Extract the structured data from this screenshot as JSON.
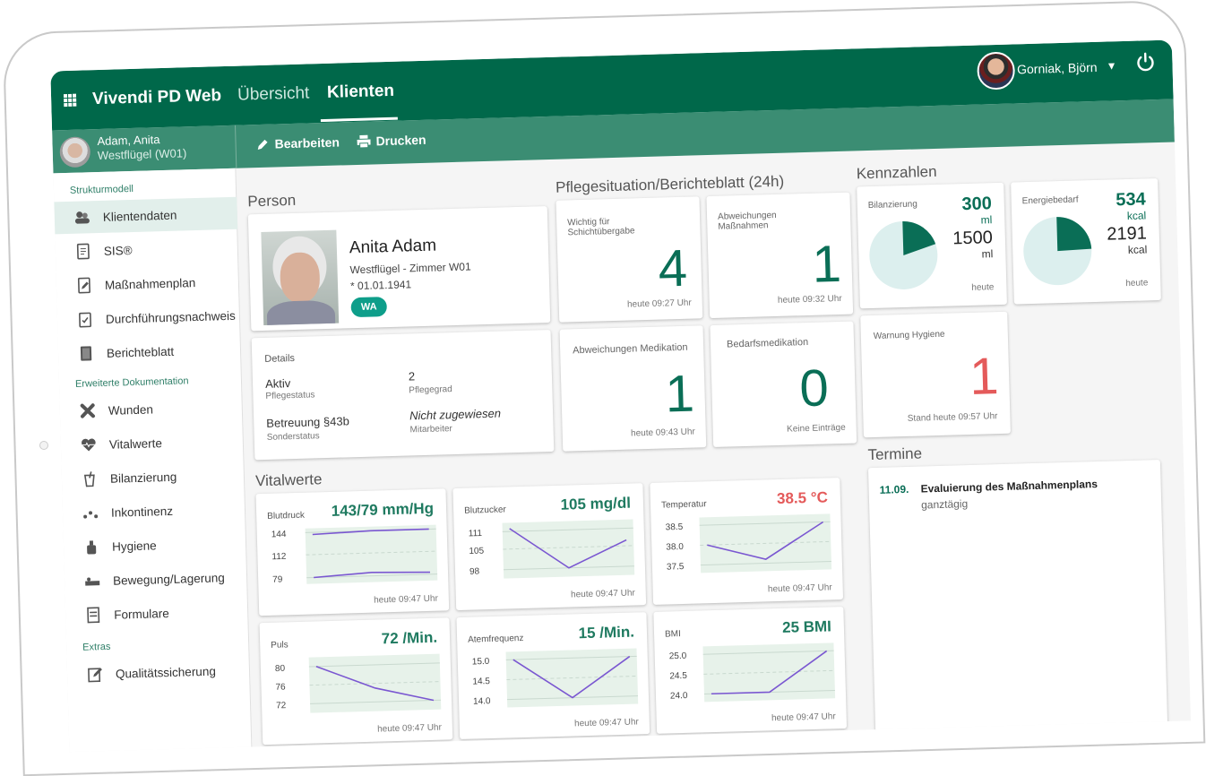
{
  "header": {
    "app_title": "Vivendi PD Web",
    "tabs": [
      {
        "label": "Übersicht"
      },
      {
        "label": "Klienten"
      }
    ],
    "user_name": "Gorniak, Björn"
  },
  "client": {
    "name": "Adam, Anita",
    "ward": "Westflügel (W01)"
  },
  "toolbar": {
    "edit_label": "Bearbeiten",
    "print_label": "Drucken"
  },
  "sidebar": {
    "sections": [
      "Strukturmodell",
      "Erweiterte Dokumentation",
      "Extras"
    ],
    "items": [
      "Klientendaten",
      "SIS®",
      "Maßnahmenplan",
      "Durchführungsnachweis",
      "Berichteblatt",
      "Wunden",
      "Vitalwerte",
      "Bilanzierung",
      "Inkontinenz",
      "Hygiene",
      "Bewegung/Lagerung",
      "Formulare",
      "Qualitätssicherung"
    ]
  },
  "person": {
    "section": "Person",
    "name": "Anita Adam",
    "location": "Westflügel - Zimmer W01",
    "birth": "* 01.01.1941",
    "badge": "WA",
    "details_title": "Details",
    "status": "Aktiv",
    "status_label": "Pflegestatus",
    "grade": "2",
    "grade_label": "Pflegegrad",
    "special": "Betreuung §43b",
    "special_label": "Sonderstatus",
    "staff": "Nicht zugewiesen",
    "staff_label": "Mitarbeiter"
  },
  "situation": {
    "section": "Pflegesituation/Berichteblatt (24h)",
    "cards": [
      {
        "title": "Wichtig für Schichtübergabe",
        "value": "4",
        "footer": "heute 09:27 Uhr"
      },
      {
        "title": "Abweichungen Maßnahmen",
        "value": "1",
        "footer": "heute 09:32 Uhr"
      },
      {
        "title": "Abweichungen Medikation",
        "value": "1",
        "footer": "heute 09:43 Uhr"
      },
      {
        "title": "Bedarfsmedikation",
        "value": "0",
        "footer": "Keine Einträge"
      }
    ]
  },
  "kennzahlen": {
    "section": "Kennzahlen",
    "bilanz": {
      "title": "Bilanzierung",
      "value": "300",
      "unit": "ml",
      "total": "1500",
      "total_unit": "ml",
      "footer": "heute",
      "fraction": 0.2
    },
    "energie": {
      "title": "Energiebedarf",
      "value": "534",
      "unit": "kcal",
      "total": "2191",
      "total_unit": "kcal",
      "footer": "heute",
      "fraction": 0.244
    },
    "hygiene": {
      "title": "Warnung Hygiene",
      "value": "1",
      "footer": "Stand heute 09:57 Uhr"
    }
  },
  "termine": {
    "section": "Termine",
    "date": "11.09.",
    "title": "Evaluierung des Maßnahmenplans",
    "time": "ganztägig"
  },
  "colors": {
    "primary": "#00684a",
    "secondary": "#3b8d73",
    "warning": "#e45a5a",
    "series": "#7a57d1"
  },
  "vitals": {
    "section": "Vitalwerte",
    "footer": "heute 09:47 Uhr",
    "chart_data": [
      {
        "type": "line",
        "title": "Blutdruck",
        "value_label": "143/79 mm/Hg",
        "ticks": [
          "144",
          "112",
          "79"
        ],
        "ylim": [
          70,
          150
        ],
        "series": [
          {
            "values": [
              141,
              144,
              144
            ]
          },
          {
            "values": [
              79,
              84,
              82
            ]
          }
        ]
      },
      {
        "type": "line",
        "title": "Blutzucker",
        "value_label": "105 mg/dl",
        "ticks": [
          "111",
          "105",
          "98"
        ],
        "ylim": [
          95,
          114
        ],
        "series": [
          {
            "values": [
              112,
              98,
              107
            ]
          }
        ]
      },
      {
        "type": "line",
        "title": "Temperatur",
        "value_label": "38.5 °C",
        "ticks": [
          "38.5",
          "38.0",
          "37.5"
        ],
        "ylim": [
          37.3,
          38.7
        ],
        "series": [
          {
            "values": [
              38.0,
              37.6,
              38.5
            ]
          }
        ]
      },
      {
        "type": "line",
        "title": "Puls",
        "value_label": "72 /Min.",
        "ticks": [
          "80",
          "76",
          "72"
        ],
        "ylim": [
          70,
          82
        ],
        "series": [
          {
            "values": [
              80,
              75,
              72
            ]
          }
        ]
      },
      {
        "type": "line",
        "title": "Atemfrequenz",
        "value_label": "15 /Min.",
        "ticks": [
          "15.0",
          "14.5",
          "14.0"
        ],
        "ylim": [
          13.8,
          15.2
        ],
        "series": [
          {
            "values": [
              15.0,
              14.0,
              15.0
            ]
          }
        ]
      },
      {
        "type": "line",
        "title": "BMI",
        "value_label": "25 BMI",
        "ticks": [
          "25.0",
          "24.5",
          "24.0"
        ],
        "ylim": [
          23.8,
          25.2
        ],
        "series": [
          {
            "values": [
              24.0,
              24.0,
              25.0
            ]
          }
        ]
      }
    ]
  }
}
